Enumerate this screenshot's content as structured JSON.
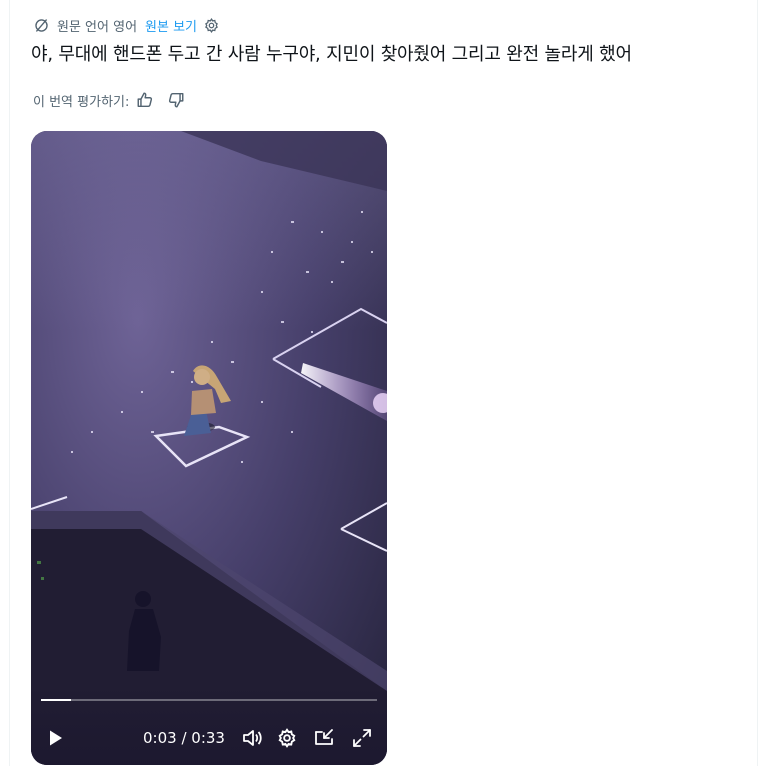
{
  "translation": {
    "source_language": "원문 언어 영어",
    "show_original_label": "원본 보기"
  },
  "post": {
    "text": "야, 무대에 핸드폰 두고 간 사람 누구야, 지민이 찾아줬어 그리고 완전 놀라게 했어"
  },
  "rating": {
    "label": "이 번역 평가하기:"
  },
  "video": {
    "current_time": "0:03",
    "duration": "0:33",
    "time_display": "0:03 / 0:33",
    "progress": 0.09
  },
  "icons": {
    "translate": "translate-icon",
    "settings": "gear-icon",
    "thumbs_up": "thumbs-up-icon",
    "thumbs_down": "thumbs-down-icon",
    "play": "play-icon",
    "volume": "volume-icon",
    "video_settings": "gear-icon",
    "pip": "picture-in-picture-icon",
    "fullscreen": "fullscreen-icon"
  },
  "colors": {
    "link": "#1d9bf0",
    "secondary_text": "#536471",
    "primary_text": "#0f1419"
  }
}
